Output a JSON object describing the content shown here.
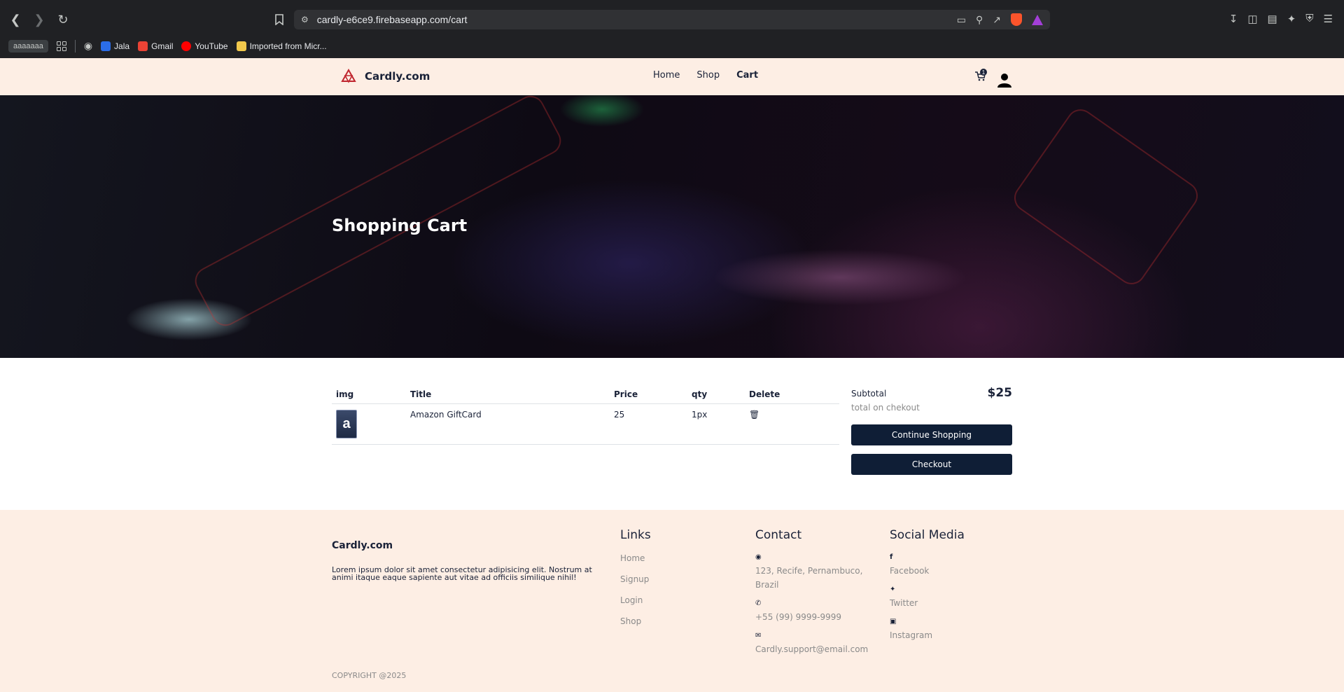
{
  "browser": {
    "url": "cardly-e6ce9.firebaseapp.com/cart",
    "profile_label": "aaaaaaa",
    "bookmarks": [
      {
        "label": "Jala",
        "icon": "jala-icon",
        "color": "#2b6de8"
      },
      {
        "label": "Gmail",
        "icon": "gmail-icon",
        "color": "#ea4335"
      },
      {
        "label": "YouTube",
        "icon": "youtube-icon",
        "color": "#ff0000"
      },
      {
        "label": "Imported from Micr...",
        "icon": "folder-icon",
        "color": "#f2c94c"
      }
    ]
  },
  "nav": {
    "brand": "Cardly.com",
    "links": [
      "Home",
      "Shop",
      "Cart"
    ],
    "active": "Cart",
    "cart_count": "1"
  },
  "hero": {
    "title": "Shopping Cart"
  },
  "cart": {
    "headers": [
      "img",
      "Title",
      "Price",
      "qty",
      "Delete"
    ],
    "items": [
      {
        "thumb": "a",
        "title": "Amazon GiftCard",
        "price": "25",
        "qty": "1px"
      }
    ]
  },
  "summary": {
    "label": "Subtotal",
    "value": "$25",
    "note": "total on chekout",
    "continue_label": "Continue Shopping",
    "checkout_label": "Checkout"
  },
  "footer": {
    "brand": "Cardly.com",
    "description": "Lorem ipsum dolor sit amet consectetur adipisicing elit. Nostrum at animi itaque eaque sapiente aut vitae ad officiis similique nihil!",
    "links_title": "Links",
    "links": [
      "Home",
      "Signup",
      "Login",
      "Shop"
    ],
    "contact_title": "Contact",
    "contact": [
      {
        "icon": "location-pin-icon",
        "text": "123, Recife, Pernambuco, Brazil"
      },
      {
        "icon": "phone-icon",
        "text": "+55 (99) 9999-9999"
      },
      {
        "icon": "mail-icon",
        "text": "Cardly.support@email.com"
      }
    ],
    "social_title": "Social Media",
    "social": [
      {
        "icon": "facebook-icon",
        "text": "Facebook"
      },
      {
        "icon": "twitter-icon",
        "text": "Twitter"
      },
      {
        "icon": "instagram-icon",
        "text": "Instagram"
      }
    ],
    "copyright": "COPYRIGHT @2025"
  },
  "colors": {
    "nav_bg": "#fdeee4",
    "accent": "#0f1e36",
    "brand_mark": "#c0262f"
  }
}
